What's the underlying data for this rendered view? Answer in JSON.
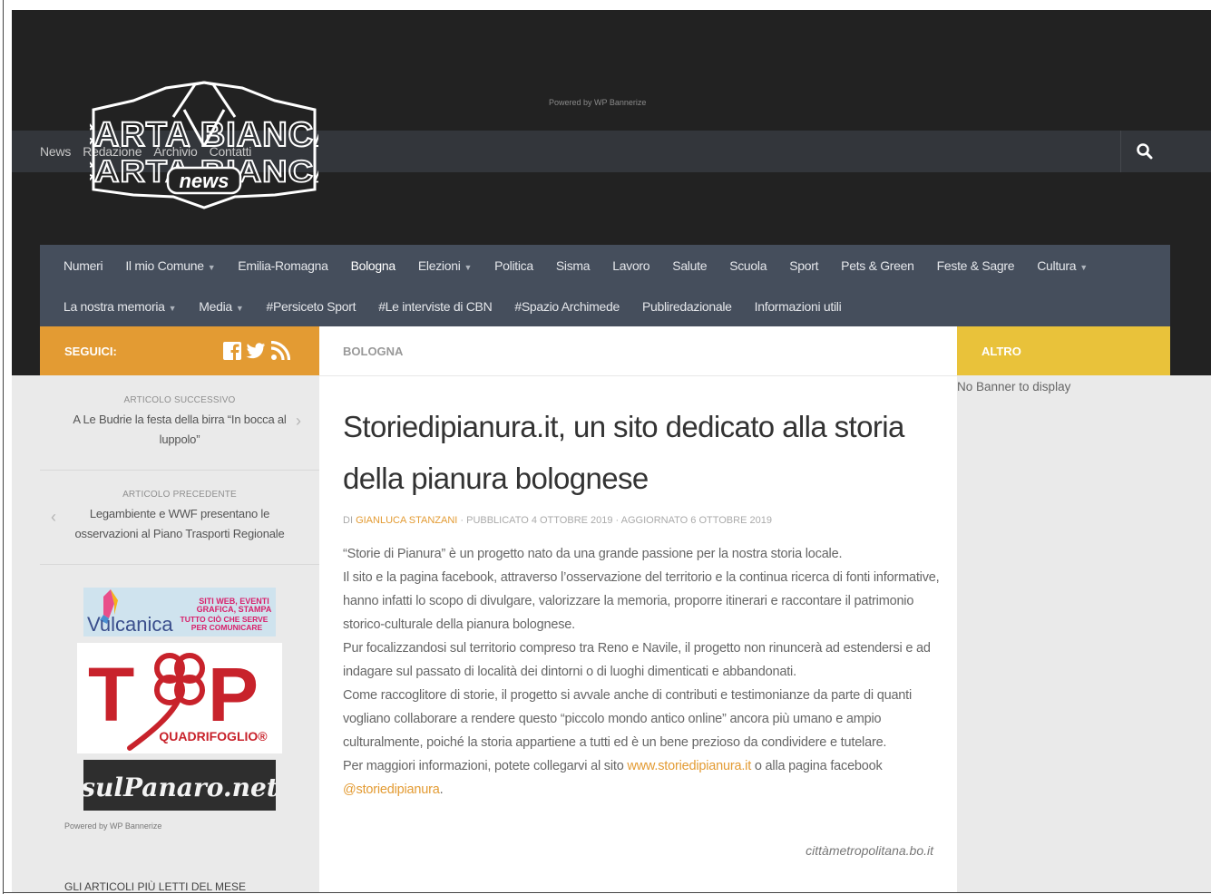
{
  "header": {
    "powered_by": "Powered by WP Bannerize",
    "logo_text_top": "CARTA BIANCA",
    "logo_text_bottom": "news",
    "top_nav": [
      "News",
      "Redazione",
      "Archivio",
      "Contatti"
    ]
  },
  "main_nav": {
    "row1": [
      {
        "label": "Numeri",
        "dropdown": false
      },
      {
        "label": "Il mio Comune",
        "dropdown": true
      },
      {
        "label": "Emilia-Romagna",
        "dropdown": false
      },
      {
        "label": "Bologna",
        "dropdown": false,
        "active": true
      },
      {
        "label": "Elezioni",
        "dropdown": true
      },
      {
        "label": "Politica",
        "dropdown": false
      },
      {
        "label": "Sisma",
        "dropdown": false
      },
      {
        "label": "Lavoro",
        "dropdown": false
      },
      {
        "label": "Salute",
        "dropdown": false
      },
      {
        "label": "Scuola",
        "dropdown": false
      },
      {
        "label": "Sport",
        "dropdown": false
      },
      {
        "label": "Pets & Green",
        "dropdown": false
      },
      {
        "label": "Feste & Sagre",
        "dropdown": false
      },
      {
        "label": "Cultura",
        "dropdown": true
      }
    ],
    "row2": [
      {
        "label": "La nostra memoria",
        "dropdown": true
      },
      {
        "label": "Media",
        "dropdown": true
      },
      {
        "label": "#Persiceto Sport",
        "dropdown": false
      },
      {
        "label": "#Le interviste di CBN",
        "dropdown": false
      },
      {
        "label": "#Spazio Archimede",
        "dropdown": false
      },
      {
        "label": "Publiredazionale",
        "dropdown": false
      },
      {
        "label": "Informazioni utili",
        "dropdown": false
      }
    ]
  },
  "sidebar_left": {
    "seguici_label": "SEGUICI:",
    "next_label": "ARTICOLO SUCCESSIVO",
    "next_title": "A Le Budrie la festa della birra “In bocca al luppolo”",
    "prev_label": "ARTICOLO PRECEDENTE",
    "prev_title": "Legambiente e WWF presentano le osservazioni al Piano Trasporti Regionale",
    "ads": {
      "vulcanica_name": "Vulcanica",
      "vulcanica_tag1": "SITI WEB, EVENTI",
      "vulcanica_tag2": "GRAFICA, STAMPA",
      "vulcanica_tag3": "TUTTO CIÒ CHE SERVE",
      "vulcanica_tag4": "PER COMUNICARE",
      "top_letters_t": "T",
      "top_letters_p": "P",
      "top_sub": "QUADRIFOGLIO®",
      "sulpanaro": "sulPanaro.net"
    },
    "powered_by": "Powered by WP Bannerize",
    "most_read_title": "GLI ARTICOLI PIÙ LETTI DEL MESE"
  },
  "article": {
    "breadcrumb": "BOLOGNA",
    "title": "Storiedipianura.it, un sito dedicato alla storia della pianura bolognese",
    "byline_prefix": "DI ",
    "author": "GIANLUCA STANZANI",
    "byline_rest": " · PUBBLICATO 4 OTTOBRE 2019 · AGGIORNATO 6 OTTOBRE 2019",
    "p1": "“Storie di Pianura” è un progetto nato da una grande passione per la nostra storia locale.",
    "p2": "Il sito e la pagina facebook, attraverso l’osservazione del territorio e la continua ricerca di fonti informative, hanno infatti lo scopo di divulgare, valorizzare la memoria, proporre itinerari e raccontare il patrimonio storico-culturale della pianura bolognese.",
    "p3": "Pur focalizzandosi sul territorio compreso tra Reno e Navile, il progetto non rinuncerà ad estendersi e ad indagare sul passato di località dei dintorni o di luoghi dimenticati e abbandonati.",
    "p4": "Come raccoglitore di storie, il progetto si avvale anche di contributi e testimonianze da parte di quanti vogliano collaborare a rendere questo “piccolo mondo antico online” ancora più umano e ampio culturalmente, poiché la storia appartiene a tutti ed è un bene prezioso da condividere e tutelare.",
    "p5_before": "Per maggiori informazioni, potete collegarvi al sito ",
    "p5_link1": "www.storiedipianura.it",
    "p5_middle": " o alla pagina facebook ",
    "p5_link2": "@storiedipianura",
    "p5_after": ".",
    "source": "cittàmetropolitana.bo.it"
  },
  "sidebar_right": {
    "altro_label": "ALTRO",
    "no_banner": "No Banner to display"
  },
  "colors": {
    "header_dark": "#222222",
    "main_nav": "#454e5c",
    "accent_orange": "#e39b33",
    "accent_yellow": "#e9c23a"
  }
}
